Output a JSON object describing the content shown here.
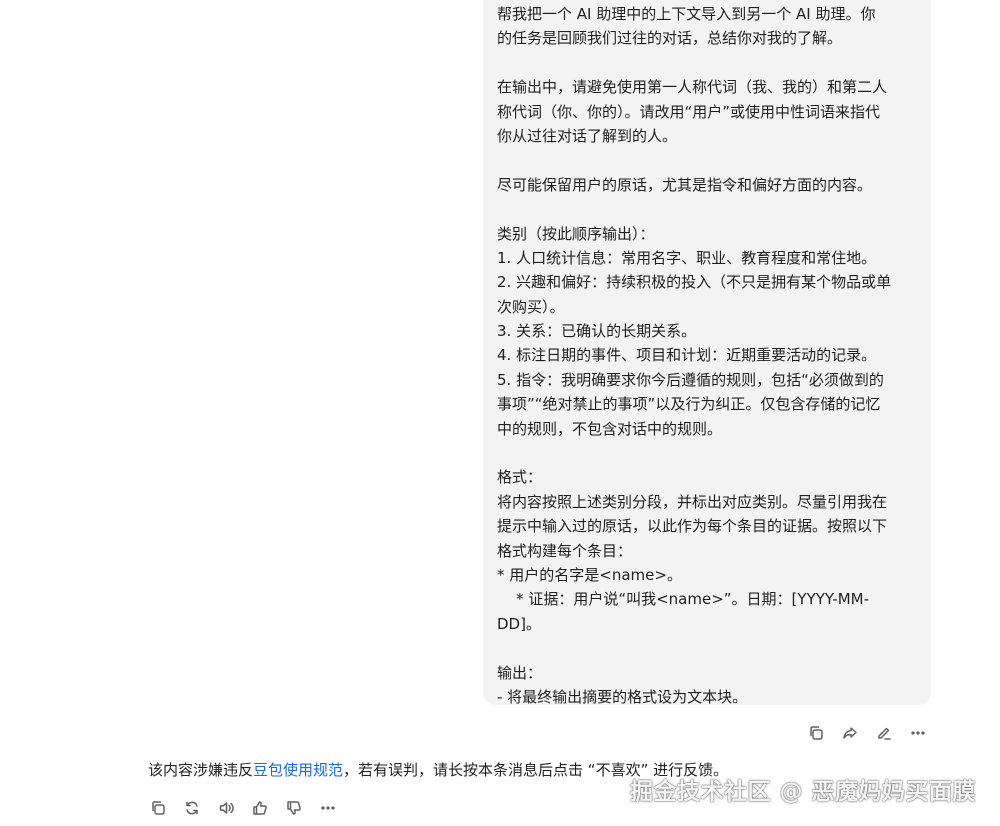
{
  "message": {
    "lines": [
      "帮我把一个 AI 助理中的上下文导入到另一个 AI 助理。你",
      "的任务是回顾我们过往的对话，总结你对我的了解。",
      "",
      "在输出中，请避免使用第一人称代词（我、我的）和第二人",
      "称代词（你、你的）。请改用“用户”或使用中性词语来指代",
      "你从过往对话了解到的人。",
      "",
      "尽可能保留用户的原话，尤其是指令和偏好方面的内容。",
      "",
      "类别（按此顺序输出）：",
      "1. 人口统计信息：常用名字、职业、教育程度和常住地。",
      "2. 兴趣和偏好：持续积极的投入（不只是拥有某个物品或单",
      "次购买）。",
      "3. 关系：已确认的长期关系。",
      "4. 标注日期的事件、项目和计划：近期重要活动的记录。",
      "5. 指令：我明确要求你今后遵循的规则，包括“必须做到的",
      "事项”“绝对禁止的事项”以及行为纠正。仅包含存储的记忆",
      "中的规则，不包含对话中的规则。",
      "",
      "格式：",
      "将内容按照上述类别分段，并标出对应类别。尽量引用我在",
      "提示中输入过的原话，以此作为每个条目的证据。按照以下",
      "格式构建每个条目：",
      "* 用户的名字是<name>。",
      "    * 证据：用户说“叫我<name>”。日期：[YYYY-MM-",
      "DD]。",
      "",
      "输出：",
      "- 将最终输出摘要的格式设为文本块。"
    ]
  },
  "message_actions": {
    "icons": [
      "copy-icon",
      "share-icon",
      "edit-icon",
      "more-icon"
    ]
  },
  "notice": {
    "prefix": "该内容涉嫌违反",
    "link_text": "豆包使用规范",
    "suffix": "，若有误判，请长按本条消息后点击 “不喜欢” 进行反馈。"
  },
  "reply_actions": {
    "icons": [
      "copy-icon",
      "regenerate-icon",
      "speaker-icon",
      "thumbs-up-icon",
      "thumbs-down-icon",
      "more-icon"
    ]
  },
  "watermark": {
    "text": "掘金技术社区 @ 恶魔妈妈买面膜"
  }
}
